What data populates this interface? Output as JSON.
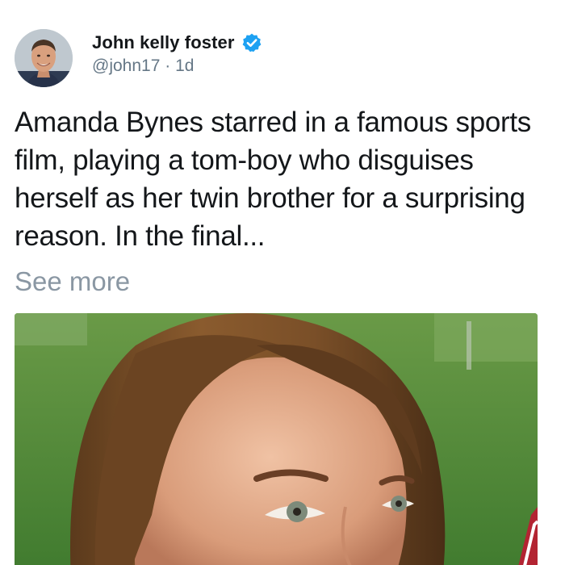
{
  "tweet": {
    "author": {
      "display_name": "John kelly foster",
      "handle": "@john17",
      "separator": "·",
      "time": "1d",
      "verified": true,
      "verified_icon": "verified-badge-icon",
      "avatar_icon": "avatar-photo"
    },
    "text": "Amanda Bynes starred in a famous sports film, playing a tom-boy who disguises herself as her twin brother for a surprising reason. In the final...",
    "see_more": "See more",
    "media": {
      "icon": "tweet-photo"
    }
  },
  "colors": {
    "text": "#14171a",
    "secondary": "#657786",
    "see_more": "#8a97a3",
    "verified": "#1da1f2"
  }
}
